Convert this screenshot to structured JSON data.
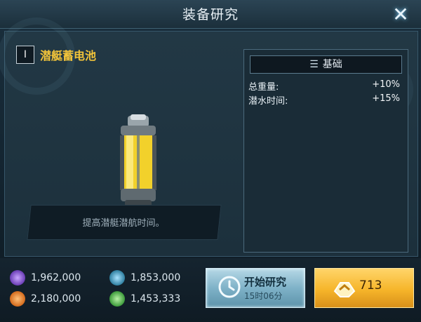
{
  "window": {
    "title": "装备研究",
    "close_icon": "close-x-icon"
  },
  "item": {
    "level": "I",
    "name": "潜艇蓄电池",
    "description": "提高潜艇潜航时间。",
    "image": "submarine-battery-icon"
  },
  "stats": {
    "header": "基础",
    "header_icon": "list-icon",
    "rows": [
      {
        "label": "总重量:",
        "value": "+10%"
      },
      {
        "label": "潜水时间:",
        "value": "+15%"
      }
    ]
  },
  "resources": [
    {
      "icon": "radiation-icon",
      "value": "1,962,000",
      "color": "#6a3db5"
    },
    {
      "icon": "layers-icon",
      "value": "1,853,000",
      "color": "#2f7fa0"
    },
    {
      "icon": "energy-icon",
      "value": "2,180,000",
      "color": "#d36a1b"
    },
    {
      "icon": "crystal-icon",
      "value": "1,453,333",
      "color": "#3c9b3a"
    }
  ],
  "actions": {
    "start_label": "开始研究",
    "start_time": "15时06分",
    "buy_price": "713",
    "buy_icon": "gold-coin-icon"
  },
  "colors": {
    "accent_gold": "#f2c43a",
    "button_blue": "#7fb2c8",
    "button_gold": "#f6b52a"
  }
}
